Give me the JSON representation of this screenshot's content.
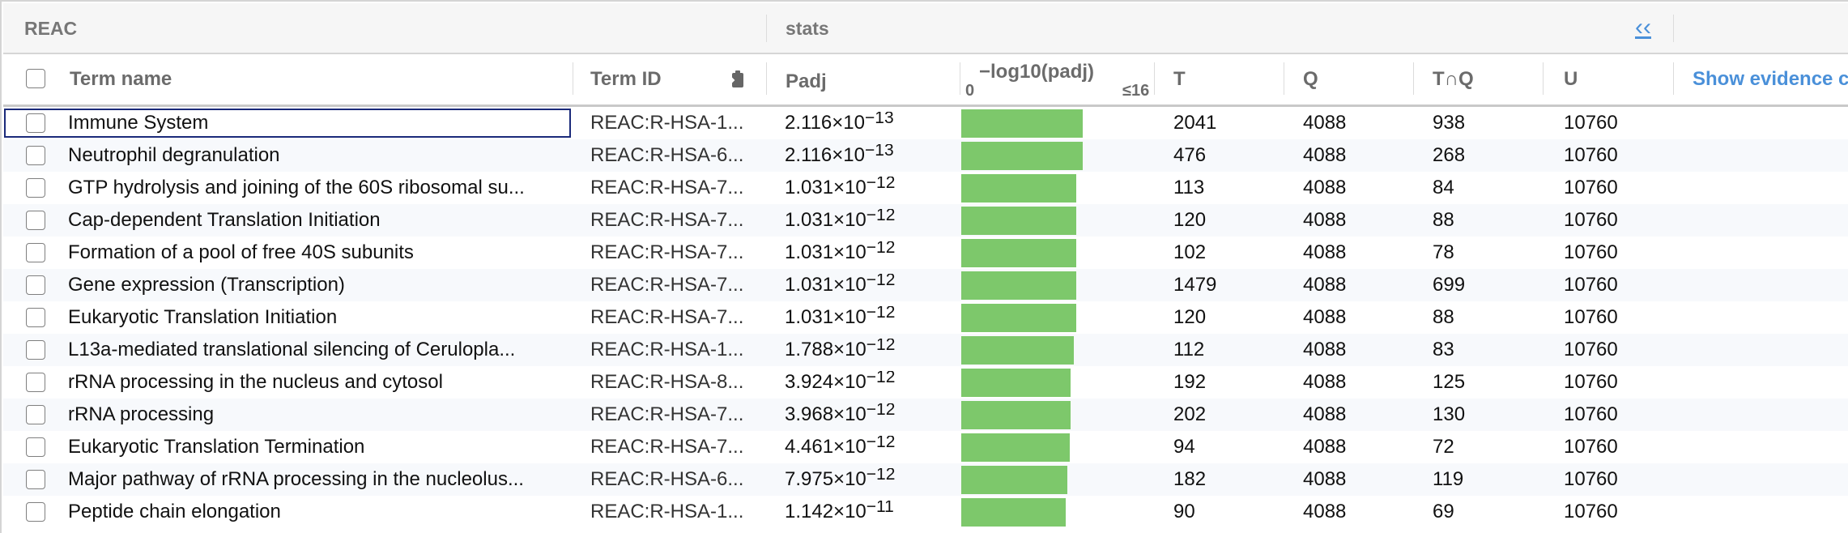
{
  "group_header": {
    "source": "REAC",
    "stats": "stats",
    "collapse_icon": "double-chevron-left"
  },
  "columns": {
    "term_name": "Term name",
    "term_id": "Term ID",
    "padj": "Padj",
    "neglog_zero": "0",
    "neglog_label": "−log10(padj)",
    "neglog_max": "≤16",
    "t": "T",
    "q": "Q",
    "tq": "T∩Q",
    "u": "U",
    "evidence": "Show evidence c"
  },
  "colors": {
    "bar": "#7dc86b",
    "link": "#4a90d9",
    "focus": "#1a2a7a"
  },
  "rows": [
    {
      "name": "Immune System",
      "id": "REAC:R-HSA-1...",
      "mant": "2.116×10",
      "exp": "−13",
      "neglog": 12.67,
      "t": "2041",
      "q": "4088",
      "tq": "938",
      "u": "10760"
    },
    {
      "name": "Neutrophil degranulation",
      "id": "REAC:R-HSA-6...",
      "mant": "2.116×10",
      "exp": "−13",
      "neglog": 12.67,
      "t": "476",
      "q": "4088",
      "tq": "268",
      "u": "10760"
    },
    {
      "name": "GTP hydrolysis and joining of the 60S ribosomal su...",
      "id": "REAC:R-HSA-7...",
      "mant": "1.031×10",
      "exp": "−12",
      "neglog": 11.99,
      "t": "113",
      "q": "4088",
      "tq": "84",
      "u": "10760"
    },
    {
      "name": "Cap-dependent Translation Initiation",
      "id": "REAC:R-HSA-7...",
      "mant": "1.031×10",
      "exp": "−12",
      "neglog": 11.99,
      "t": "120",
      "q": "4088",
      "tq": "88",
      "u": "10760"
    },
    {
      "name": "Formation of a pool of free 40S subunits",
      "id": "REAC:R-HSA-7...",
      "mant": "1.031×10",
      "exp": "−12",
      "neglog": 11.99,
      "t": "102",
      "q": "4088",
      "tq": "78",
      "u": "10760"
    },
    {
      "name": "Gene expression (Transcription)",
      "id": "REAC:R-HSA-7...",
      "mant": "1.031×10",
      "exp": "−12",
      "neglog": 11.99,
      "t": "1479",
      "q": "4088",
      "tq": "699",
      "u": "10760"
    },
    {
      "name": "Eukaryotic Translation Initiation",
      "id": "REAC:R-HSA-7...",
      "mant": "1.031×10",
      "exp": "−12",
      "neglog": 11.99,
      "t": "120",
      "q": "4088",
      "tq": "88",
      "u": "10760"
    },
    {
      "name": "L13a-mediated translational silencing of Ceruloplа...",
      "id": "REAC:R-HSA-1...",
      "mant": "1.788×10",
      "exp": "−12",
      "neglog": 11.75,
      "t": "112",
      "q": "4088",
      "tq": "83",
      "u": "10760"
    },
    {
      "name": "rRNA processing in the nucleus and cytosol",
      "id": "REAC:R-HSA-8...",
      "mant": "3.924×10",
      "exp": "−12",
      "neglog": 11.41,
      "t": "192",
      "q": "4088",
      "tq": "125",
      "u": "10760"
    },
    {
      "name": "rRNA processing",
      "id": "REAC:R-HSA-7...",
      "mant": "3.968×10",
      "exp": "−12",
      "neglog": 11.4,
      "t": "202",
      "q": "4088",
      "tq": "130",
      "u": "10760"
    },
    {
      "name": "Eukaryotic Translation Termination",
      "id": "REAC:R-HSA-7...",
      "mant": "4.461×10",
      "exp": "−12",
      "neglog": 11.35,
      "t": "94",
      "q": "4088",
      "tq": "72",
      "u": "10760"
    },
    {
      "name": "Major pathway of rRNA processing in the nucleolus...",
      "id": "REAC:R-HSA-6...",
      "mant": "7.975×10",
      "exp": "−12",
      "neglog": 11.1,
      "t": "182",
      "q": "4088",
      "tq": "119",
      "u": "10760"
    },
    {
      "name": "Peptide chain elongation",
      "id": "REAC:R-HSA-1...",
      "mant": "1.142×10",
      "exp": "−11",
      "neglog": 10.94,
      "t": "90",
      "q": "4088",
      "tq": "69",
      "u": "10760"
    }
  ]
}
